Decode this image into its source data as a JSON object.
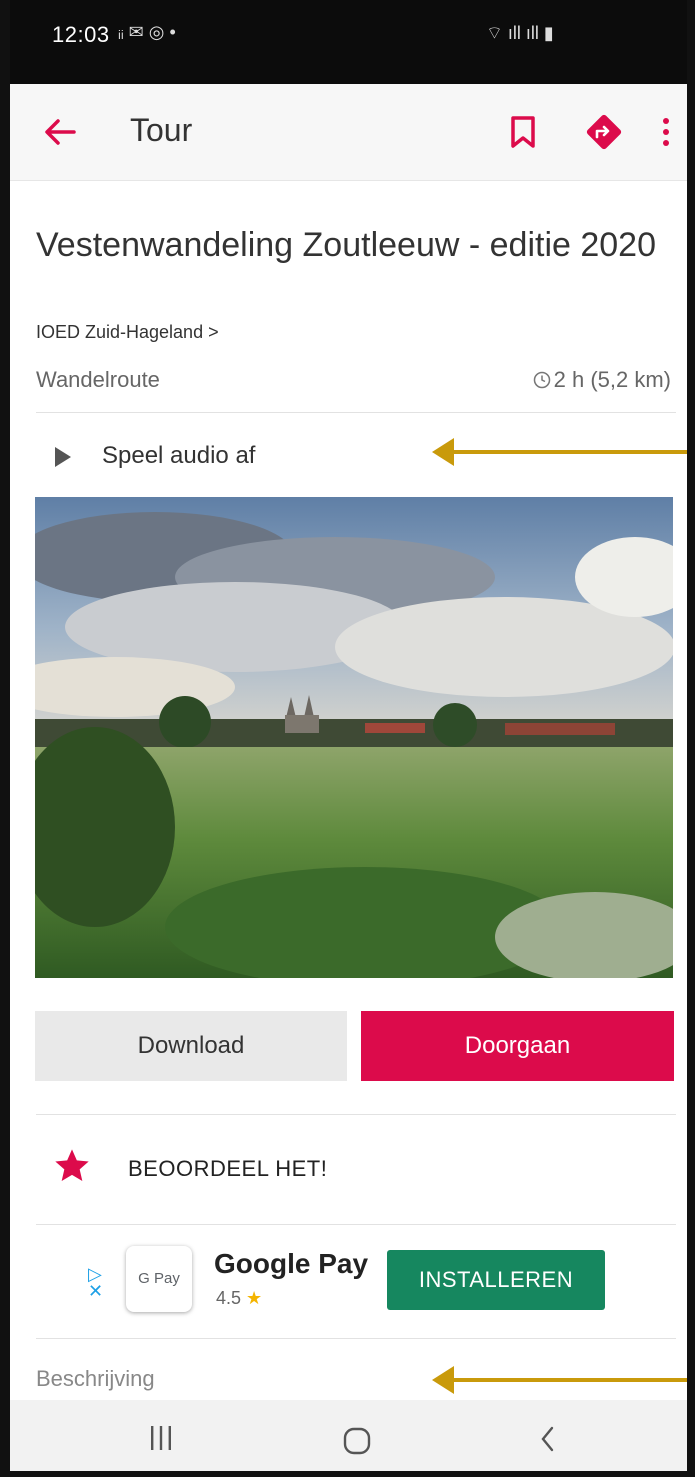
{
  "status_bar": {
    "time": "12:03",
    "left_icons": "ᵢᵢ ✉ ◎ •",
    "right_icons": "⌔ ıll ıll ▮"
  },
  "app_bar": {
    "title": "Tour"
  },
  "tour": {
    "title": "Vestenwandeling Zoutleeuw - editie 2020",
    "publisher": "IOED Zuid-Hageland  >",
    "type": "Wandelroute",
    "duration": "2 h (5,2 km)"
  },
  "audio": {
    "label": "Speel audio af"
  },
  "actions": {
    "download_label": "Download",
    "continue_label": "Doorgaan"
  },
  "rating": {
    "label": "BEOORDEEL HET!"
  },
  "ad": {
    "app_icon_text": "G Pay",
    "app_name": "Google Pay",
    "rating_value": "4.5",
    "install_label": "INSTALLEREN"
  },
  "description": {
    "label": "Beschrijving"
  },
  "colors": {
    "accent": "#DC0B4B",
    "install_green": "#16875F",
    "annotation_arrow": "#C99A0B"
  },
  "icons": [
    "back-arrow-icon",
    "bookmark-icon",
    "directions-icon",
    "more-vert-icon",
    "clock-icon",
    "play-icon",
    "star-icon",
    "adchoices-icon",
    "nav-recent-icon",
    "nav-home-icon",
    "nav-back-icon"
  ]
}
